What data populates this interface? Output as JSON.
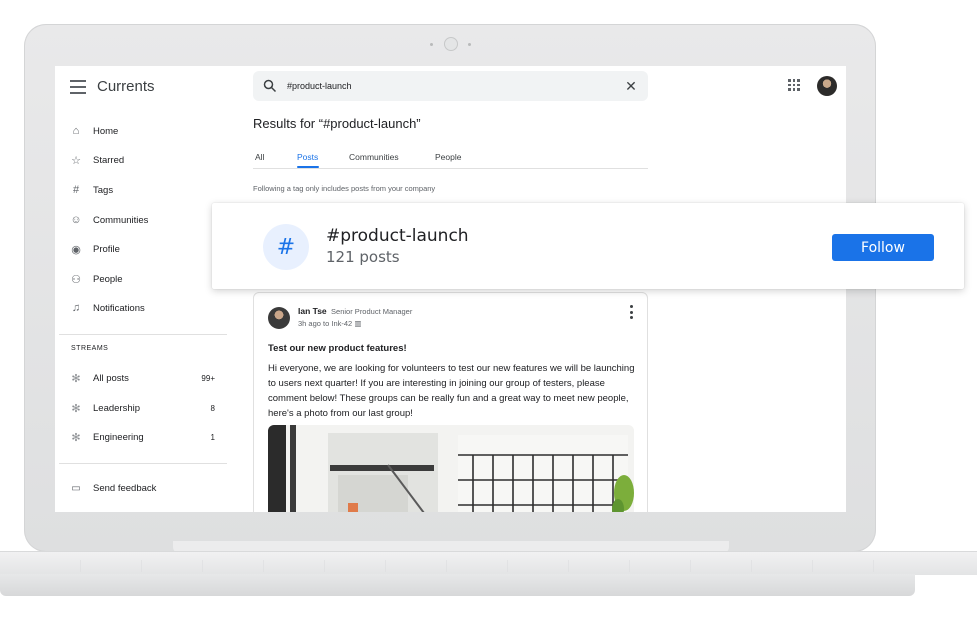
{
  "app": {
    "title": "Currents"
  },
  "search": {
    "value": "#product-launch",
    "clear_icon": "close-icon"
  },
  "sidebar": {
    "items": [
      {
        "label": "Home",
        "icon": "home-icon"
      },
      {
        "label": "Starred",
        "icon": "star-icon"
      },
      {
        "label": "Tags",
        "icon": "hash-icon"
      },
      {
        "label": "Communities",
        "icon": "communities-icon"
      },
      {
        "label": "Profile",
        "icon": "profile-icon"
      },
      {
        "label": "People",
        "icon": "people-icon"
      },
      {
        "label": "Notifications",
        "icon": "bell-icon"
      }
    ],
    "streams_label": "STREAMS",
    "streams": [
      {
        "label": "All posts",
        "count": "99+"
      },
      {
        "label": "Leadership",
        "count": "8"
      },
      {
        "label": "Engineering",
        "count": "1"
      }
    ],
    "feedback_label": "Send feedback"
  },
  "results": {
    "title": "Results for “#product-launch”",
    "tabs": [
      {
        "label": "All"
      },
      {
        "label": "Posts",
        "active": true
      },
      {
        "label": "Communities"
      },
      {
        "label": "People"
      }
    ],
    "note": "Following a tag only includes posts from your company"
  },
  "tag_card": {
    "name": "#product-launch",
    "count": "121 posts",
    "follow_label": "Follow",
    "accent": "#1a73e8"
  },
  "post": {
    "author": "Ian Tse",
    "role": "Senior Product Manager",
    "meta": "3h ago to Ink-42",
    "title": "Test our new product features!",
    "body": "Hi everyone, we are looking for volunteers to test our new features we will be launching to users next quarter! If you are interesting in joining our group of testers, please comment below! These groups can be really fun and a great way to meet new people, here's a photo from our last group!"
  }
}
